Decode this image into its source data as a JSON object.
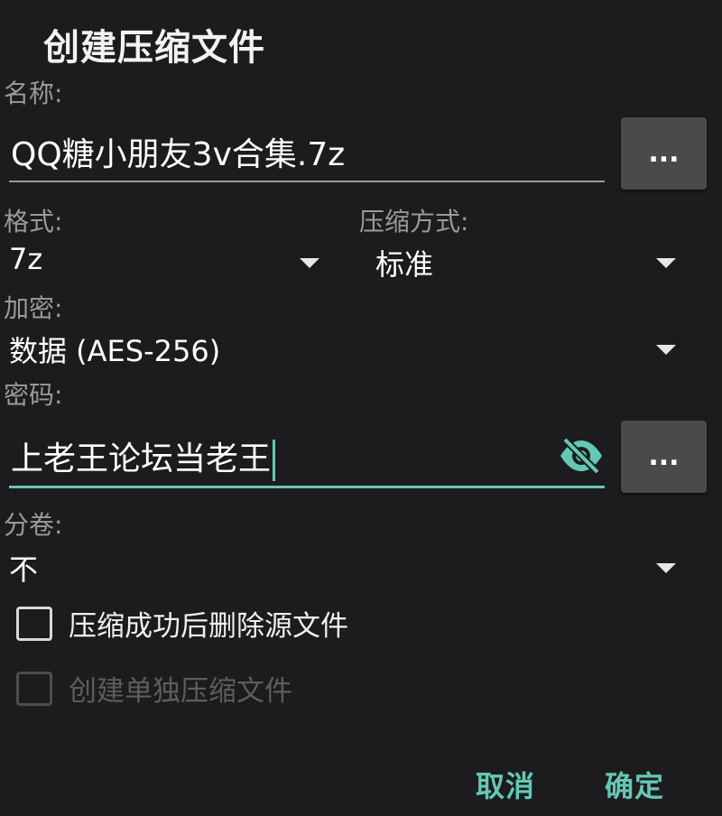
{
  "dialog": {
    "title": "创建压缩文件"
  },
  "name_field": {
    "label": "名称:",
    "value": "QQ糖小朋友3v合集.7z",
    "browse_label": "..."
  },
  "format": {
    "label": "格式:",
    "selected": "7z"
  },
  "compression": {
    "label": "压缩方式:",
    "selected": "标准"
  },
  "encryption": {
    "label": "加密:",
    "selected": "数据 (AES-256)"
  },
  "password": {
    "label": "密码:",
    "value": "上老王论坛当老王",
    "browse_label": "...",
    "visibility_icon": "eye-off-icon"
  },
  "volumes": {
    "label": "分卷:",
    "selected": "不"
  },
  "options": {
    "delete_source_label": "压缩成功后删除源文件",
    "delete_source_checked": false,
    "separate_archives_label": "创建单独压缩文件",
    "separate_archives_checked": false,
    "separate_archives_enabled": false
  },
  "actions": {
    "cancel_label": "取消",
    "ok_label": "确定"
  },
  "colors": {
    "accent": "#64c8b4",
    "background": "#1c1c1e",
    "button_bg": "#4a4a4a",
    "label_gray": "#9a9a9a"
  }
}
